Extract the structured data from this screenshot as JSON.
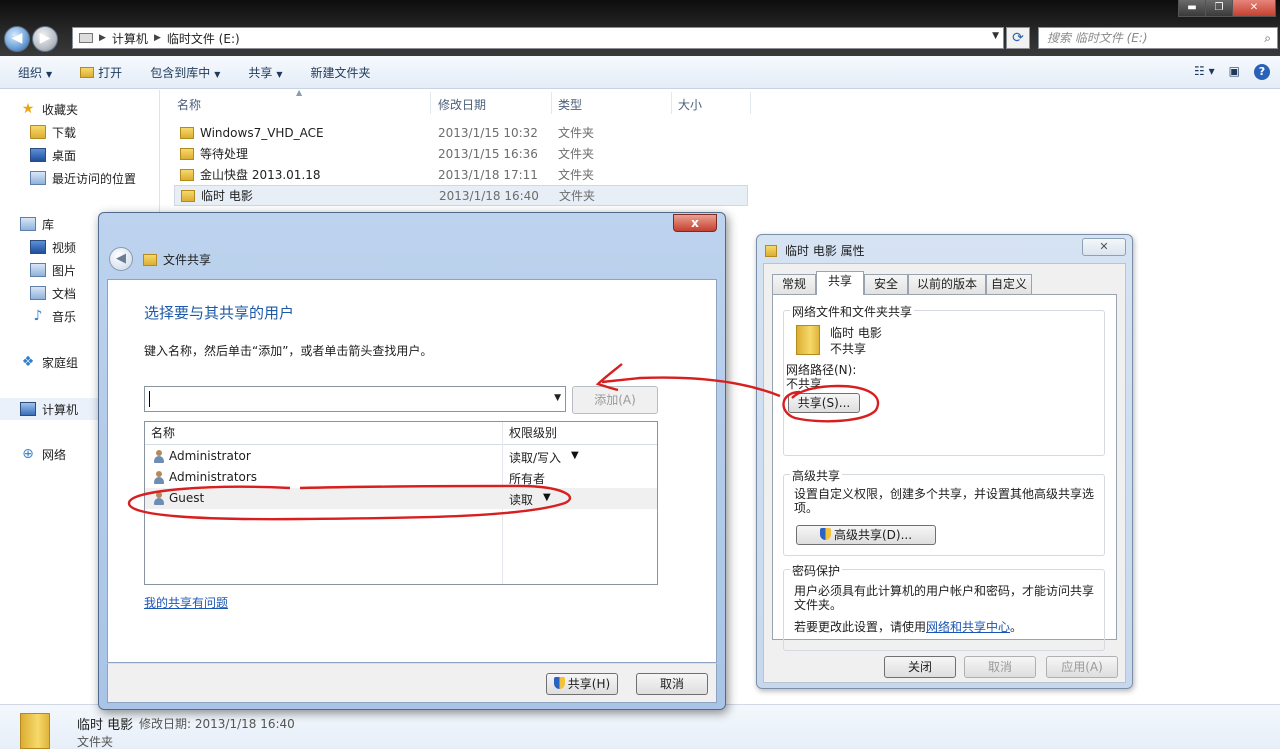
{
  "explorer": {
    "breadcrumb": [
      "计算机",
      "临时文件 (E:)"
    ],
    "search_placeholder": "搜索 临时文件 (E:)",
    "window_controls": {
      "minimize": "▬",
      "maximize": "❐",
      "close": "✕"
    },
    "nav": {
      "back": "◀",
      "forward": "▶"
    },
    "toolbar": {
      "organize": "组织",
      "open": "打开",
      "include_library": "包含到库中",
      "share": "共享",
      "new_folder": "新建文件夹"
    },
    "sidebar": {
      "favorites": "收藏夹",
      "downloads": "下载",
      "desktop": "桌面",
      "recent": "最近访问的位置",
      "libraries": "库",
      "videos": "视频",
      "pictures": "图片",
      "documents": "文档",
      "music": "音乐",
      "homegroup": "家庭组",
      "computer": "计算机",
      "network": "网络"
    },
    "columns": {
      "name": "名称",
      "date": "修改日期",
      "type": "类型",
      "size": "大小"
    },
    "files": [
      {
        "name": "Windows7_VHD_ACE",
        "date": "2013/1/15 10:32",
        "type": "文件夹"
      },
      {
        "name": "等待处理",
        "date": "2013/1/15 16:36",
        "type": "文件夹"
      },
      {
        "name": "金山快盘 2013.01.18",
        "date": "2013/1/18 17:11",
        "type": "文件夹"
      },
      {
        "name": "临时 电影",
        "date": "2013/1/18 16:40",
        "type": "文件夹"
      }
    ],
    "details": {
      "name": "临时 电影",
      "modified_label": "修改日期: 2013/1/18 16:40",
      "type": "文件夹"
    }
  },
  "share_dialog": {
    "close": "x",
    "title": "文件共享",
    "heading": "选择要与其共享的用户",
    "instruction": "键入名称，然后单击“添加”，或者单击箭头查找用户。",
    "add_button": "添加(A)",
    "col_name": "名称",
    "col_permission": "权限级别",
    "users": [
      {
        "name": "Administrator",
        "permission": "读取/写入"
      },
      {
        "name": "Administrators",
        "permission": "所有者"
      },
      {
        "name": "Guest",
        "permission": "读取"
      }
    ],
    "help_link": "我的共享有问题",
    "share_button": "共享(H)",
    "cancel_button": "取消"
  },
  "properties_dialog": {
    "title": "临时 电影 属性",
    "tabs": [
      "常规",
      "共享",
      "安全",
      "以前的版本",
      "自定义"
    ],
    "network_sharing": {
      "group_label": "网络文件和文件夹共享",
      "folder_name": "临时 电影",
      "status": "不共享",
      "path_label": "网络路径(N):",
      "path_value": "不共享",
      "share_button": "共享(S)..."
    },
    "advanced_sharing": {
      "group_label": "高级共享",
      "description_line1": "设置自定义权限，创建多个共享，并设置其他高级共享选",
      "description_line2": "项。",
      "button": "高级共享(D)..."
    },
    "password_protection": {
      "group_label": "密码保护",
      "description_line1": "用户必须具有此计算机的用户帐户和密码，才能访问共享",
      "description_line2": "文件夹。",
      "change_prefix": "若要更改此设置，请使用",
      "change_link": "网络和共享中心",
      "change_suffix": "。"
    },
    "buttons": {
      "close": "关闭",
      "cancel": "取消",
      "apply": "应用(A)"
    }
  },
  "colors": {
    "annotation": "#d81e1e",
    "link": "#1c56b5",
    "heading": "#1e5aa8"
  }
}
